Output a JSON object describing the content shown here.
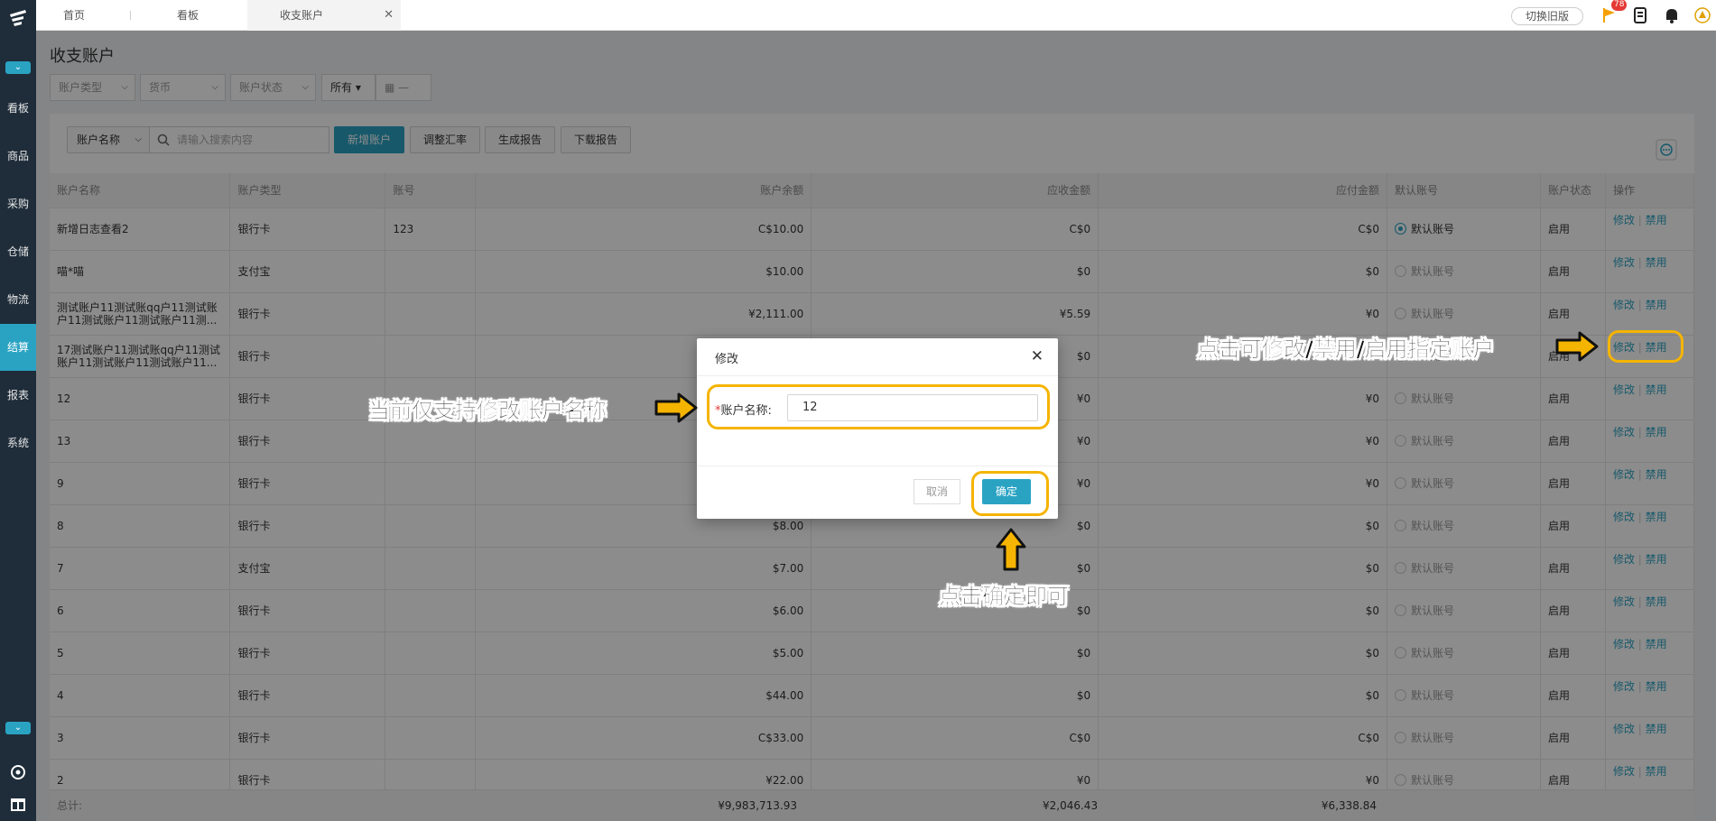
{
  "sidebar": {
    "items": [
      {
        "label": "看板"
      },
      {
        "label": "商品"
      },
      {
        "label": "采购"
      },
      {
        "label": "仓储"
      },
      {
        "label": "物流"
      },
      {
        "label": "结算",
        "active": true
      },
      {
        "label": "报表"
      },
      {
        "label": "系统"
      }
    ]
  },
  "topbar": {
    "tabs": [
      {
        "label": "首页"
      },
      {
        "label": "看板"
      },
      {
        "label": "收支账户"
      }
    ],
    "switch_label": "切换旧版",
    "badge_count": "78"
  },
  "page": {
    "title": "收支账户",
    "filters": {
      "account_type": "账户类型",
      "currency": "货币",
      "account_status": "账户状态",
      "all": "所有",
      "date_sep": "—"
    }
  },
  "toolbar": {
    "field_select": "账户名称",
    "search_placeholder": "请输入搜索内容",
    "add_label": "新增账户",
    "adjust_label": "调整汇率",
    "report_label": "生成报告",
    "download_label": "下载报告"
  },
  "table": {
    "columns": [
      "账户名称",
      "账户类型",
      "账号",
      "账户余额",
      "应收金额",
      "应付金额",
      "默认账号",
      "账户状态",
      "操作"
    ],
    "rows": [
      {
        "name": "新增日志查看2",
        "type": "银行卡",
        "no": "123",
        "balance": "C$10.00",
        "recv": "C$0",
        "pay": "C$0",
        "default": true,
        "status": "启用"
      },
      {
        "name": "喵*喵",
        "type": "支付宝",
        "no": "",
        "balance": "$10.00",
        "recv": "$0",
        "pay": "$0",
        "default": false,
        "status": "启用"
      },
      {
        "name": "测试账户11测试账qq户11测试账户11测试账户11测试账户11测...",
        "type": "银行卡",
        "no": "",
        "balance": "¥2,111.00",
        "recv": "¥5.59",
        "pay": "¥0",
        "default": false,
        "status": "启用"
      },
      {
        "name": "17测试账户11测试账qq户11测试账户11测试账户11测试账户11...",
        "type": "银行卡",
        "no": "",
        "balance": "",
        "recv": "$0",
        "pay": "",
        "default": false,
        "status": "启用"
      },
      {
        "name": "12",
        "type": "银行卡",
        "no": "",
        "balance": "",
        "recv": "¥0",
        "pay": "¥0",
        "default": false,
        "status": "启用"
      },
      {
        "name": "13",
        "type": "银行卡",
        "no": "",
        "balance": "",
        "recv": "¥0",
        "pay": "¥0",
        "default": false,
        "status": "启用"
      },
      {
        "name": "9",
        "type": "银行卡",
        "no": "",
        "balance": "",
        "recv": "¥0",
        "pay": "¥0",
        "default": false,
        "status": "启用"
      },
      {
        "name": "8",
        "type": "银行卡",
        "no": "",
        "balance": "$8.00",
        "recv": "$0",
        "pay": "$0",
        "default": false,
        "status": "启用"
      },
      {
        "name": "7",
        "type": "支付宝",
        "no": "",
        "balance": "$7.00",
        "recv": "$0",
        "pay": "$0",
        "default": false,
        "status": "启用"
      },
      {
        "name": "6",
        "type": "银行卡",
        "no": "",
        "balance": "$6.00",
        "recv": "$0",
        "pay": "$0",
        "default": false,
        "status": "启用"
      },
      {
        "name": "5",
        "type": "银行卡",
        "no": "",
        "balance": "$5.00",
        "recv": "$0",
        "pay": "$0",
        "default": false,
        "status": "启用"
      },
      {
        "name": "4",
        "type": "银行卡",
        "no": "",
        "balance": "$44.00",
        "recv": "$0",
        "pay": "$0",
        "default": false,
        "status": "启用"
      },
      {
        "name": "3",
        "type": "银行卡",
        "no": "",
        "balance": "C$33.00",
        "recv": "C$0",
        "pay": "C$0",
        "default": false,
        "status": "启用"
      },
      {
        "name": "2",
        "type": "银行卡",
        "no": "",
        "balance": "¥22.00",
        "recv": "¥0",
        "pay": "¥0",
        "default": false,
        "status": "启用"
      }
    ],
    "default_label": "默认账号",
    "edit_label": "修改",
    "disable_label": "禁用",
    "total_label": "总计:",
    "total_balance": "¥9,983,713.93",
    "total_recv": "¥2,046.43",
    "total_pay": "¥6,338.84"
  },
  "modal": {
    "title": "修改",
    "required_mark": "*",
    "field_label": "账户名称:",
    "field_value": "12",
    "cancel_label": "取消",
    "ok_label": "确定"
  },
  "annotations": {
    "left_note": "当前仅支持修改账户名称",
    "right_note": "点击可修改/禁用/启用指定账户",
    "bottom_note": "点击确定即可"
  },
  "colors": {
    "accent": "#2aa3c3",
    "sidebar_bg": "#1f2d3a",
    "highlight": "#f5b400"
  }
}
